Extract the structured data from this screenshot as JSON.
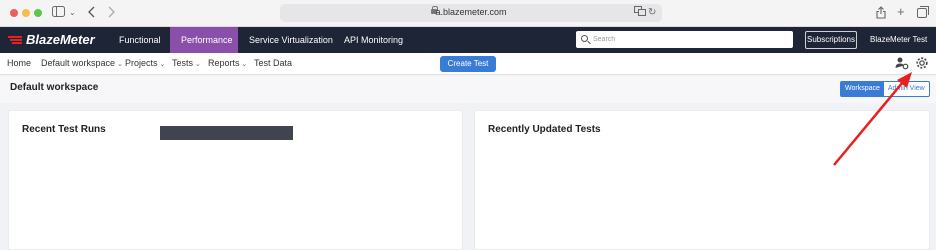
{
  "browser": {
    "url": "a.blazemeter.com"
  },
  "topnav": {
    "logo": "BlazeMeter",
    "items": [
      {
        "label": "Functional",
        "active": false
      },
      {
        "label": "Performance",
        "active": true
      },
      {
        "label": "Service Virtualization",
        "active": false
      },
      {
        "label": "API Monitoring",
        "active": false
      }
    ],
    "search_placeholder": "Search",
    "subscriptions_label": "Subscriptions",
    "user_label": "BlazeMeter Test"
  },
  "subnav": {
    "items": [
      {
        "label": "Home",
        "has_caret": false
      },
      {
        "label": "Default workspace",
        "has_caret": true
      },
      {
        "label": "Projects",
        "has_caret": true
      },
      {
        "label": "Tests",
        "has_caret": true
      },
      {
        "label": "Reports",
        "has_caret": true
      },
      {
        "label": "Test Data",
        "has_caret": false
      }
    ],
    "create_test_label": "Create Test"
  },
  "workspace": {
    "title": "Default workspace",
    "view_toggle": {
      "active": "Workspace",
      "inactive": "Admin View"
    }
  },
  "panels": {
    "recent_runs_title": "Recent Test Runs",
    "recently_updated_title": "Recently Updated Tests"
  },
  "colors": {
    "topnav_bg": "#1e2536",
    "active_tab": "#8a4fa8",
    "primary_button": "#3a7bd5",
    "annotation": "#e8201e",
    "logo_accent": "#e8201e"
  },
  "icons": [
    "sidebar-icon",
    "back-icon",
    "forward-icon",
    "lock-icon",
    "translate-icon",
    "reload-icon",
    "share-icon",
    "new-tab-icon",
    "tabs-icon",
    "search-icon",
    "user-settings-icon",
    "gear-icon"
  ]
}
